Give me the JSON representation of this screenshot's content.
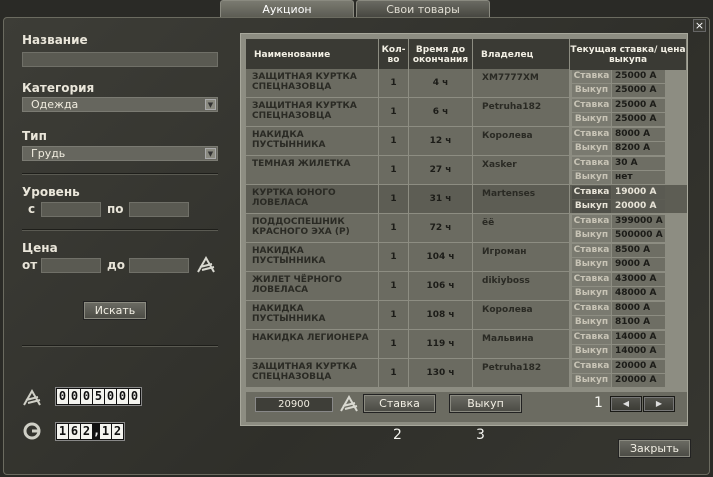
{
  "tabs": [
    "Аукцион",
    "Свои товары"
  ],
  "close_icon": "×",
  "filters": {
    "name_label": "Название",
    "category_label": "Категория",
    "category_value": "Одежда",
    "type_label": "Тип",
    "type_value": "Грудь",
    "level_label": "Уровень",
    "level_from": "с",
    "level_to": "по",
    "price_label": "Цена",
    "price_from": "от",
    "price_to": "до",
    "search_button": "Искать"
  },
  "currency": {
    "amount": "0005000",
    "gold": "162,12"
  },
  "table": {
    "headers": [
      "Наименование",
      "Кол-во",
      "Время до окончания",
      "Владелец",
      "Текущая ставка/ цена выкупа"
    ],
    "bid_label": "Ставка",
    "buyout_label": "Выкуп",
    "rows": [
      {
        "name": "ЗАЩИТНАЯ КУРТКА СПЕЦНАЗОВЦА",
        "qty": "1",
        "time": "4 ч",
        "owner": "XM7777XM",
        "bid": "25000 A",
        "buyout": "25000 A"
      },
      {
        "name": "ЗАЩИТНАЯ КУРТКА СПЕЦНАЗОВЦА",
        "qty": "1",
        "time": "6 ч",
        "owner": "Petruha182",
        "bid": "25000 A",
        "buyout": "25000 A"
      },
      {
        "name": "НАКИДКА ПУСТЫННИКА",
        "qty": "1",
        "time": "12 ч",
        "owner": "Королева",
        "bid": "8000 A",
        "buyout": "8200 A"
      },
      {
        "name": "ТЕМНАЯ ЖИЛЕТКА",
        "qty": "1",
        "time": "27 ч",
        "owner": "Xasker",
        "bid": "30 A",
        "buyout": "нет"
      },
      {
        "name": "КУРТКА ЮНОГО ЛОВЕЛАСА",
        "qty": "1",
        "time": "31 ч",
        "owner": "Martenses",
        "bid": "19000 A",
        "buyout": "20000 A"
      },
      {
        "name": "ПОДДОСПЕШНИК КРАСНОГО ЭХА (Р)",
        "qty": "1",
        "time": "72 ч",
        "owner": "ёё",
        "bid": "399000 A",
        "buyout": "500000 A"
      },
      {
        "name": "НАКИДКА ПУСТЫННИКА",
        "qty": "1",
        "time": "104 ч",
        "owner": "Игроман",
        "bid": "8500 A",
        "buyout": "9000 A"
      },
      {
        "name": "ЖИЛЕТ ЧЁРНОГО ЛОВЕЛАСА",
        "qty": "1",
        "time": "106 ч",
        "owner": "dikiyboss",
        "bid": "43000 A",
        "buyout": "48000 A"
      },
      {
        "name": "НАКИДКА ПУСТЫННИКА",
        "qty": "1",
        "time": "108 ч",
        "owner": "Королева",
        "bid": "8000 A",
        "buyout": "8100 A"
      },
      {
        "name": "НАКИДКА ЛЕГИОНЕРА",
        "qty": "1",
        "time": "119 ч",
        "owner": "Мальвина",
        "bid": "14000 A",
        "buyout": "14000 A"
      },
      {
        "name": "ЗАЩИТНАЯ КУРТКА СПЕЦНАЗОВЦА",
        "qty": "1",
        "time": "130 ч",
        "owner": "Petruha182",
        "bid": "20000 A",
        "buyout": "20000 A"
      }
    ]
  },
  "bottom": {
    "price": "20900",
    "bid_button": "Ставка",
    "buyout_button": "Выкуп",
    "page": "1",
    "prev": "◀",
    "next": "▶",
    "label2": "2",
    "label3": "3",
    "close_button": "Закрыть"
  }
}
